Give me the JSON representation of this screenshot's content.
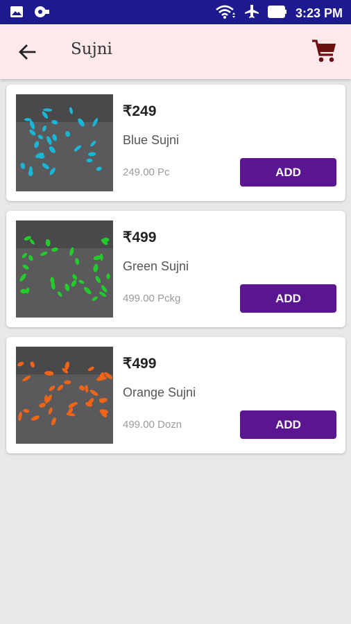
{
  "status_bar": {
    "time": "3:23 PM",
    "icons": [
      "gallery-icon",
      "camera-icon",
      "wifi-icon",
      "airplane-icon",
      "battery-icon"
    ]
  },
  "app_bar": {
    "title": "Sujni",
    "back_icon": "arrow-left-icon",
    "cart_icon": "shopping-cart-icon"
  },
  "colors": {
    "status_bar": "#1c1a8e",
    "app_bar": "#fde8ec",
    "button": "#5a1591",
    "background": "#e8e8e8"
  },
  "products": [
    {
      "price": "₹249",
      "name": "Blue Sujni",
      "unit": "249.00 Pc",
      "button": "ADD",
      "bead_color": "#18b7d8"
    },
    {
      "price": "₹499",
      "name": "Green Sujni",
      "unit": "499.00 Pckg",
      "button": "ADD",
      "bead_color": "#22cc2a"
    },
    {
      "price": "₹499",
      "name": "Orange Sujni",
      "unit": "499.00 Dozn",
      "button": "ADD",
      "bead_color": "#f06418"
    }
  ]
}
